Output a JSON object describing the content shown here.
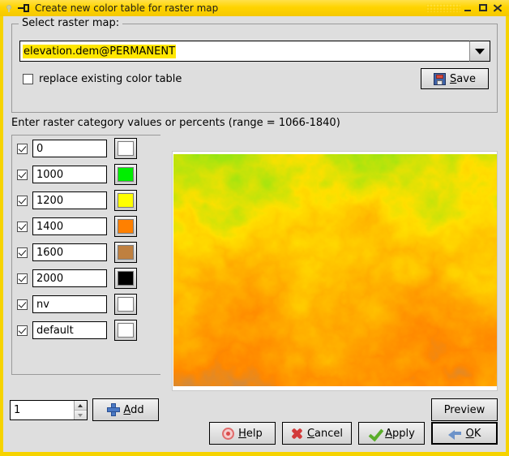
{
  "window": {
    "title": "Create new color table for raster map",
    "titlebar_icons": [
      "pin-icon",
      "minimize-icon",
      "maximize-icon",
      "close-icon"
    ]
  },
  "raster_group": {
    "title": "Select raster map:",
    "combo_value": "elevation.dem@PERMANENT",
    "combo_icon": "chevron-down-icon",
    "replace_checkbox": {
      "label": "replace existing color table",
      "checked": false
    },
    "save_button": {
      "label_pre": "",
      "accel": "S",
      "label_post": "ave",
      "icon": "floppy-disk-icon"
    }
  },
  "category_section": {
    "label": "Enter raster category values or percents (range = 1066-1840)",
    "range_min": 1066,
    "range_max": 1840,
    "rows": [
      {
        "checked": true,
        "value": "0",
        "color": "#ffffff"
      },
      {
        "checked": true,
        "value": "1000",
        "color": "#00ee00"
      },
      {
        "checked": true,
        "value": "1200",
        "color": "#ffff00"
      },
      {
        "checked": true,
        "value": "1400",
        "color": "#ff8000"
      },
      {
        "checked": true,
        "value": "1600",
        "color": "#bf8040"
      },
      {
        "checked": true,
        "value": "2000",
        "color": "#000000"
      },
      {
        "checked": true,
        "value": "nv",
        "color": "#ffffff"
      },
      {
        "checked": true,
        "value": "default",
        "color": "#ffffff"
      }
    ]
  },
  "preview": {
    "alt": "elevation DEM raster preview",
    "colors": [
      "#00ee00",
      "#ffff00",
      "#ff8000",
      "#8a6b4a"
    ]
  },
  "add_row": {
    "spinner_value": "1",
    "spinner_up_icon": "triangle-up-icon",
    "spinner_down_icon": "triangle-down-icon",
    "add_button": {
      "accel": "A",
      "label_post": "dd",
      "icon": "plus-icon"
    },
    "preview_button": {
      "label": "Preview"
    }
  },
  "dialog_buttons": [
    {
      "name": "help",
      "accel": "H",
      "label_post": "elp",
      "label_pre": "",
      "icon": "life-ring-icon",
      "default": false
    },
    {
      "name": "cancel",
      "accel": "C",
      "label_post": "ancel",
      "label_pre": "",
      "icon": "x-mark-icon",
      "default": false
    },
    {
      "name": "apply",
      "accel": "A",
      "label_post": "pply",
      "label_pre": "",
      "icon": "check-icon",
      "default": false
    },
    {
      "name": "ok",
      "accel": "O",
      "label_post": "K",
      "label_pre": "",
      "icon": "enter-arrow-icon",
      "default": true
    }
  ],
  "colors": {
    "titlebar": "#ffd400",
    "window_border": "#f6d300",
    "client_bg": "#dedede",
    "highlight": "#ffe600"
  }
}
